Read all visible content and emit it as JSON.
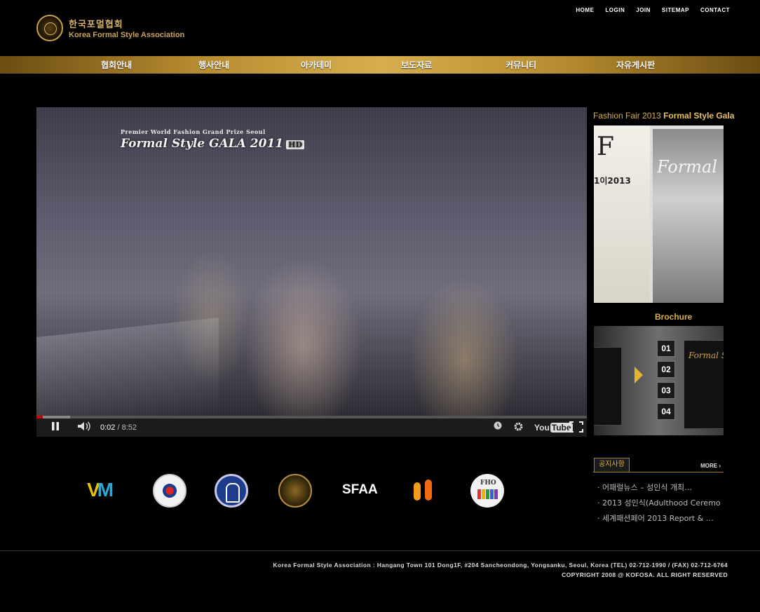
{
  "header": {
    "logo_ko": "한국포멀협회",
    "logo_en": "Korea Formal Style Association",
    "top_links": [
      "HOME",
      "LOGIN",
      "JOIN",
      "SITEMAP",
      "CONTACT"
    ]
  },
  "menu": [
    "협회안내",
    "행사안내",
    "아카데미",
    "보도자료",
    "커뮤니티",
    "자유게시판"
  ],
  "video": {
    "overlay_sub": "Premier World Fashion Grand Prize Seoul",
    "overlay_title": "Formal Style GALA 2011",
    "overlay_badge": "HD",
    "current_time": "0:02",
    "separator": " / ",
    "duration": "8:52",
    "progress_fraction": 0.0038,
    "youtube_label": "You",
    "youtube_tube": "Tube"
  },
  "sidebar": {
    "fair_title_a": "Fashion Fair 2013",
    "fair_title_b": "Formal Style Gala",
    "fair_poster_f": "F",
    "fair_poster_year": "1이2013",
    "fair_poster_gala": "Formal",
    "brochure_title": "Brochure",
    "brochure_numbers": [
      "01",
      "02",
      "03",
      "04"
    ],
    "brochure_book_title": "Formal St"
  },
  "notice": {
    "title": "공지사항",
    "more": "MORE ›",
    "items": [
      "· 어패럴뉴스 – 성인식 개최…",
      "· 2013 성인식(Adulthood Ceremo",
      "· 세계패션페어 2013 Report & …"
    ]
  },
  "partners": {
    "vm": "V",
    "vm_m": "M",
    "sfaa": "SFAA",
    "fho": "FHO"
  },
  "footer": {
    "address": "Korea Formal Style Association : Hangang Town 101 Dong1F, #204 Sancheondong, Yongsanku, Seoul, Korea (TEL) 02-712-1990 / (FAX) 02-712-6764",
    "copyright": "COPYRIGHT 2008 @ KOFOSA. ALL RIGHT RESERVED"
  },
  "colors": {
    "accent_gold": "#d8b04a",
    "progress_red": "#cc0000",
    "background": "#000000"
  }
}
